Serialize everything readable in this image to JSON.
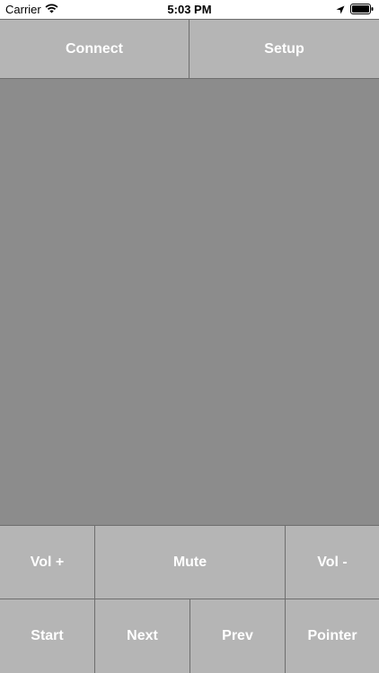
{
  "status_bar": {
    "carrier": "Carrier",
    "time": "5:03 PM",
    "icons": [
      "wifi-icon",
      "location-arrow-icon",
      "battery-icon"
    ]
  },
  "top_buttons": {
    "connect": "Connect",
    "setup": "Setup"
  },
  "volume_row": {
    "vol_up": "Vol +",
    "mute": "Mute",
    "vol_down": "Vol -"
  },
  "control_row": {
    "start": "Start",
    "next": "Next",
    "prev": "Prev",
    "pointer": "Pointer"
  },
  "colors": {
    "button_bg": "#b5b5b5",
    "touchpad_bg": "#8c8c8c",
    "divider": "#6e6e6e",
    "label": "#ffffff"
  }
}
